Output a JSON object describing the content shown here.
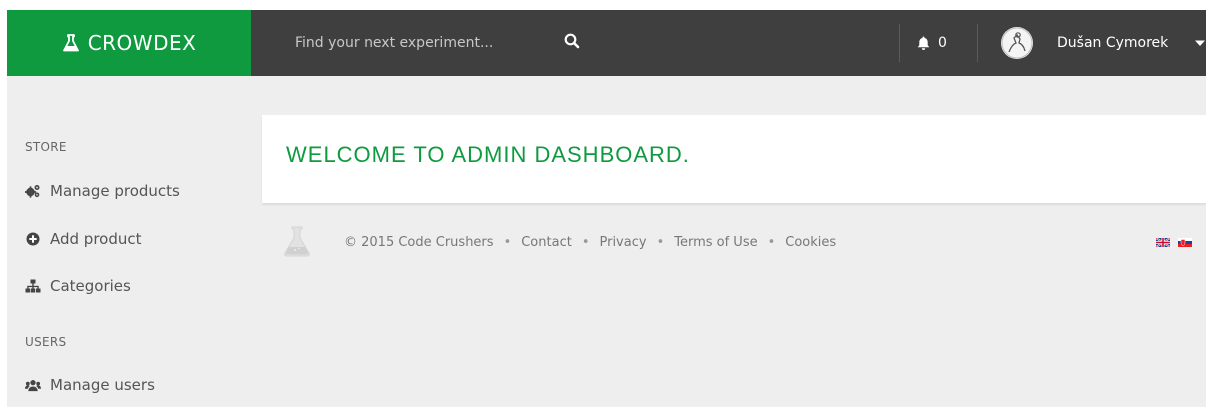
{
  "brand": {
    "name": "CROWDEX",
    "color": "#0f9a40"
  },
  "search": {
    "placeholder": "Find your next experiment..."
  },
  "notifications": {
    "count": "0"
  },
  "user": {
    "name": "Dušan Cymorek"
  },
  "sidebar": {
    "sections": [
      {
        "title": "STORE",
        "items": [
          {
            "label": "Manage products",
            "icon": "cogs-icon"
          },
          {
            "label": "Add product",
            "icon": "plus-circle-icon"
          },
          {
            "label": "Categories",
            "icon": "sitemap-icon"
          }
        ]
      },
      {
        "title": "USERS",
        "items": [
          {
            "label": "Manage users",
            "icon": "users-icon"
          }
        ]
      }
    ]
  },
  "main": {
    "welcome": "WELCOME TO ADMIN DASHBOARD."
  },
  "footer": {
    "copyright": "© 2015 Code Crushers",
    "links": [
      "Contact",
      "Privacy",
      "Terms of Use",
      "Cookies"
    ],
    "languages": [
      "en-flag-icon",
      "sk-flag-icon"
    ]
  }
}
